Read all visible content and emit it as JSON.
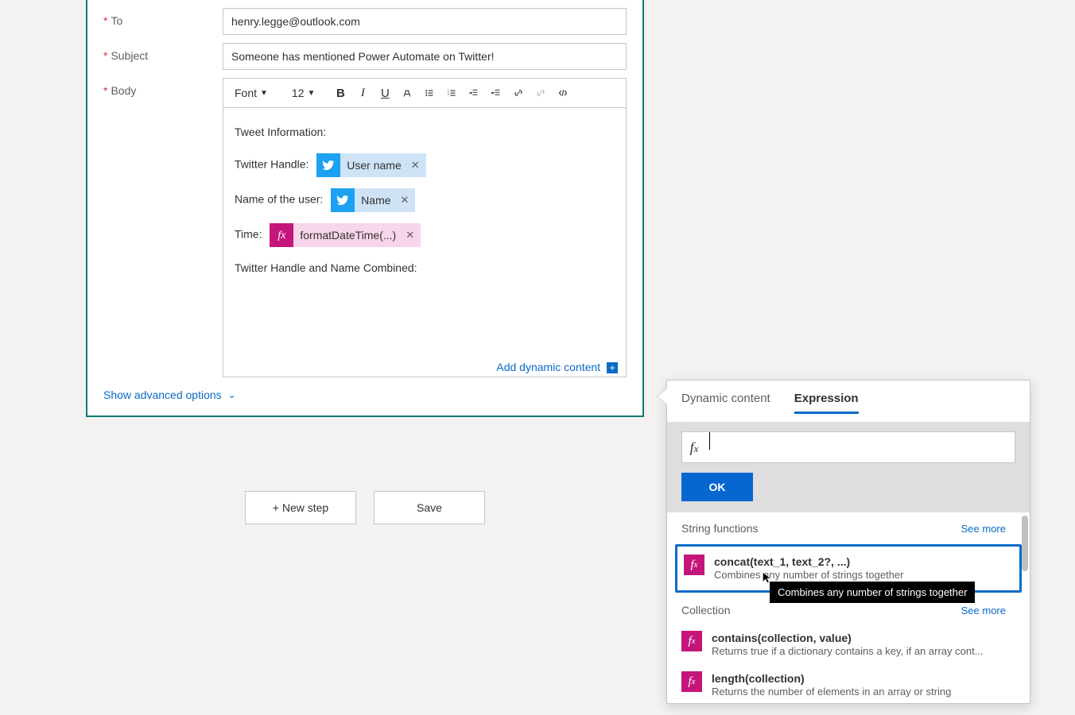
{
  "email": {
    "fields": {
      "to_label": "To",
      "to_value": "henry.legge@outlook.com",
      "subject_label": "Subject",
      "subject_value": "Someone has mentioned Power Automate on Twitter!",
      "body_label": "Body"
    },
    "toolbar": {
      "font_label": "Font",
      "font_size": "12"
    },
    "body": {
      "line1": "Tweet Information:",
      "handle_label": "Twitter Handle:",
      "handle_token": "User name",
      "name_label": "Name of the user:",
      "name_token": "Name",
      "time_label": "Time:",
      "time_token": "formatDateTime(...)",
      "combined_label": "Twitter Handle and Name Combined:"
    },
    "add_dynamic": "Add dynamic content",
    "advanced": "Show advanced options"
  },
  "actions": {
    "new_step": "+ New step",
    "save": "Save"
  },
  "dyn_panel": {
    "tabs": {
      "content": "Dynamic content",
      "expression": "Expression"
    },
    "ok": "OK",
    "categories": {
      "string": {
        "title": "String functions",
        "see_more": "See more"
      },
      "collection": {
        "title": "Collection",
        "see_more": "See more"
      }
    },
    "fns": {
      "concat": {
        "sig": "concat(text_1, text_2?, ...)",
        "desc": "Combines any number of strings together",
        "tooltip": "Combines any number of strings together"
      },
      "contains": {
        "sig": "contains(collection, value)",
        "desc": "Returns true if a dictionary contains a key, if an array cont..."
      },
      "length": {
        "sig": "length(collection)",
        "desc": "Returns the number of elements in an array or string"
      }
    }
  }
}
